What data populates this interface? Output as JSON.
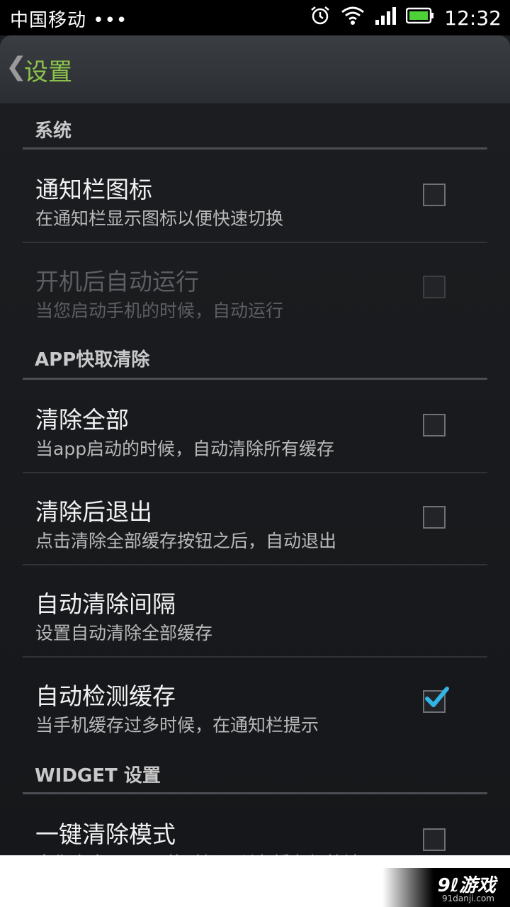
{
  "status_bar": {
    "carrier": "中国移动 •••",
    "time": "12:32"
  },
  "title_bar": {
    "back_icon": "chevron-left-icon",
    "title": "设置"
  },
  "sections": [
    {
      "header": "系统",
      "rows": [
        {
          "title": "通知栏图标",
          "subtitle": "在通知栏显示图标以便快速切换",
          "checked": false,
          "enabled": true
        },
        {
          "title": "开机后自动运行",
          "subtitle": "当您启动手机的时候，自动运行",
          "checked": false,
          "enabled": false
        }
      ]
    },
    {
      "header": "APP快取清除",
      "rows": [
        {
          "title": "清除全部",
          "subtitle": "当app启动的时候，自动清除所有缓存",
          "checked": false,
          "enabled": true
        },
        {
          "title": "清除后退出",
          "subtitle": "点击清除全部缓存按钮之后，自动退出",
          "checked": false,
          "enabled": true
        },
        {
          "title": "自动清除间隔",
          "subtitle": "设置自动清除全部缓存"
        },
        {
          "title": "自动检测缓存",
          "subtitle": "当手机缓存过多时候，在通知栏提示",
          "checked": true,
          "enabled": true
        }
      ]
    },
    {
      "header": "WIDGET 设置",
      "rows": [
        {
          "title": "一键清除模式",
          "subtitle": "当你点击widget的时候，所有缓存都将被",
          "checked": false,
          "enabled": true
        }
      ]
    }
  ],
  "watermark": {
    "logo": "9ℓ游戏",
    "url": "91danji.com"
  },
  "colors": {
    "accent": "#8bc34a",
    "check": "#33b5e5",
    "background": "#1b1d20"
  }
}
